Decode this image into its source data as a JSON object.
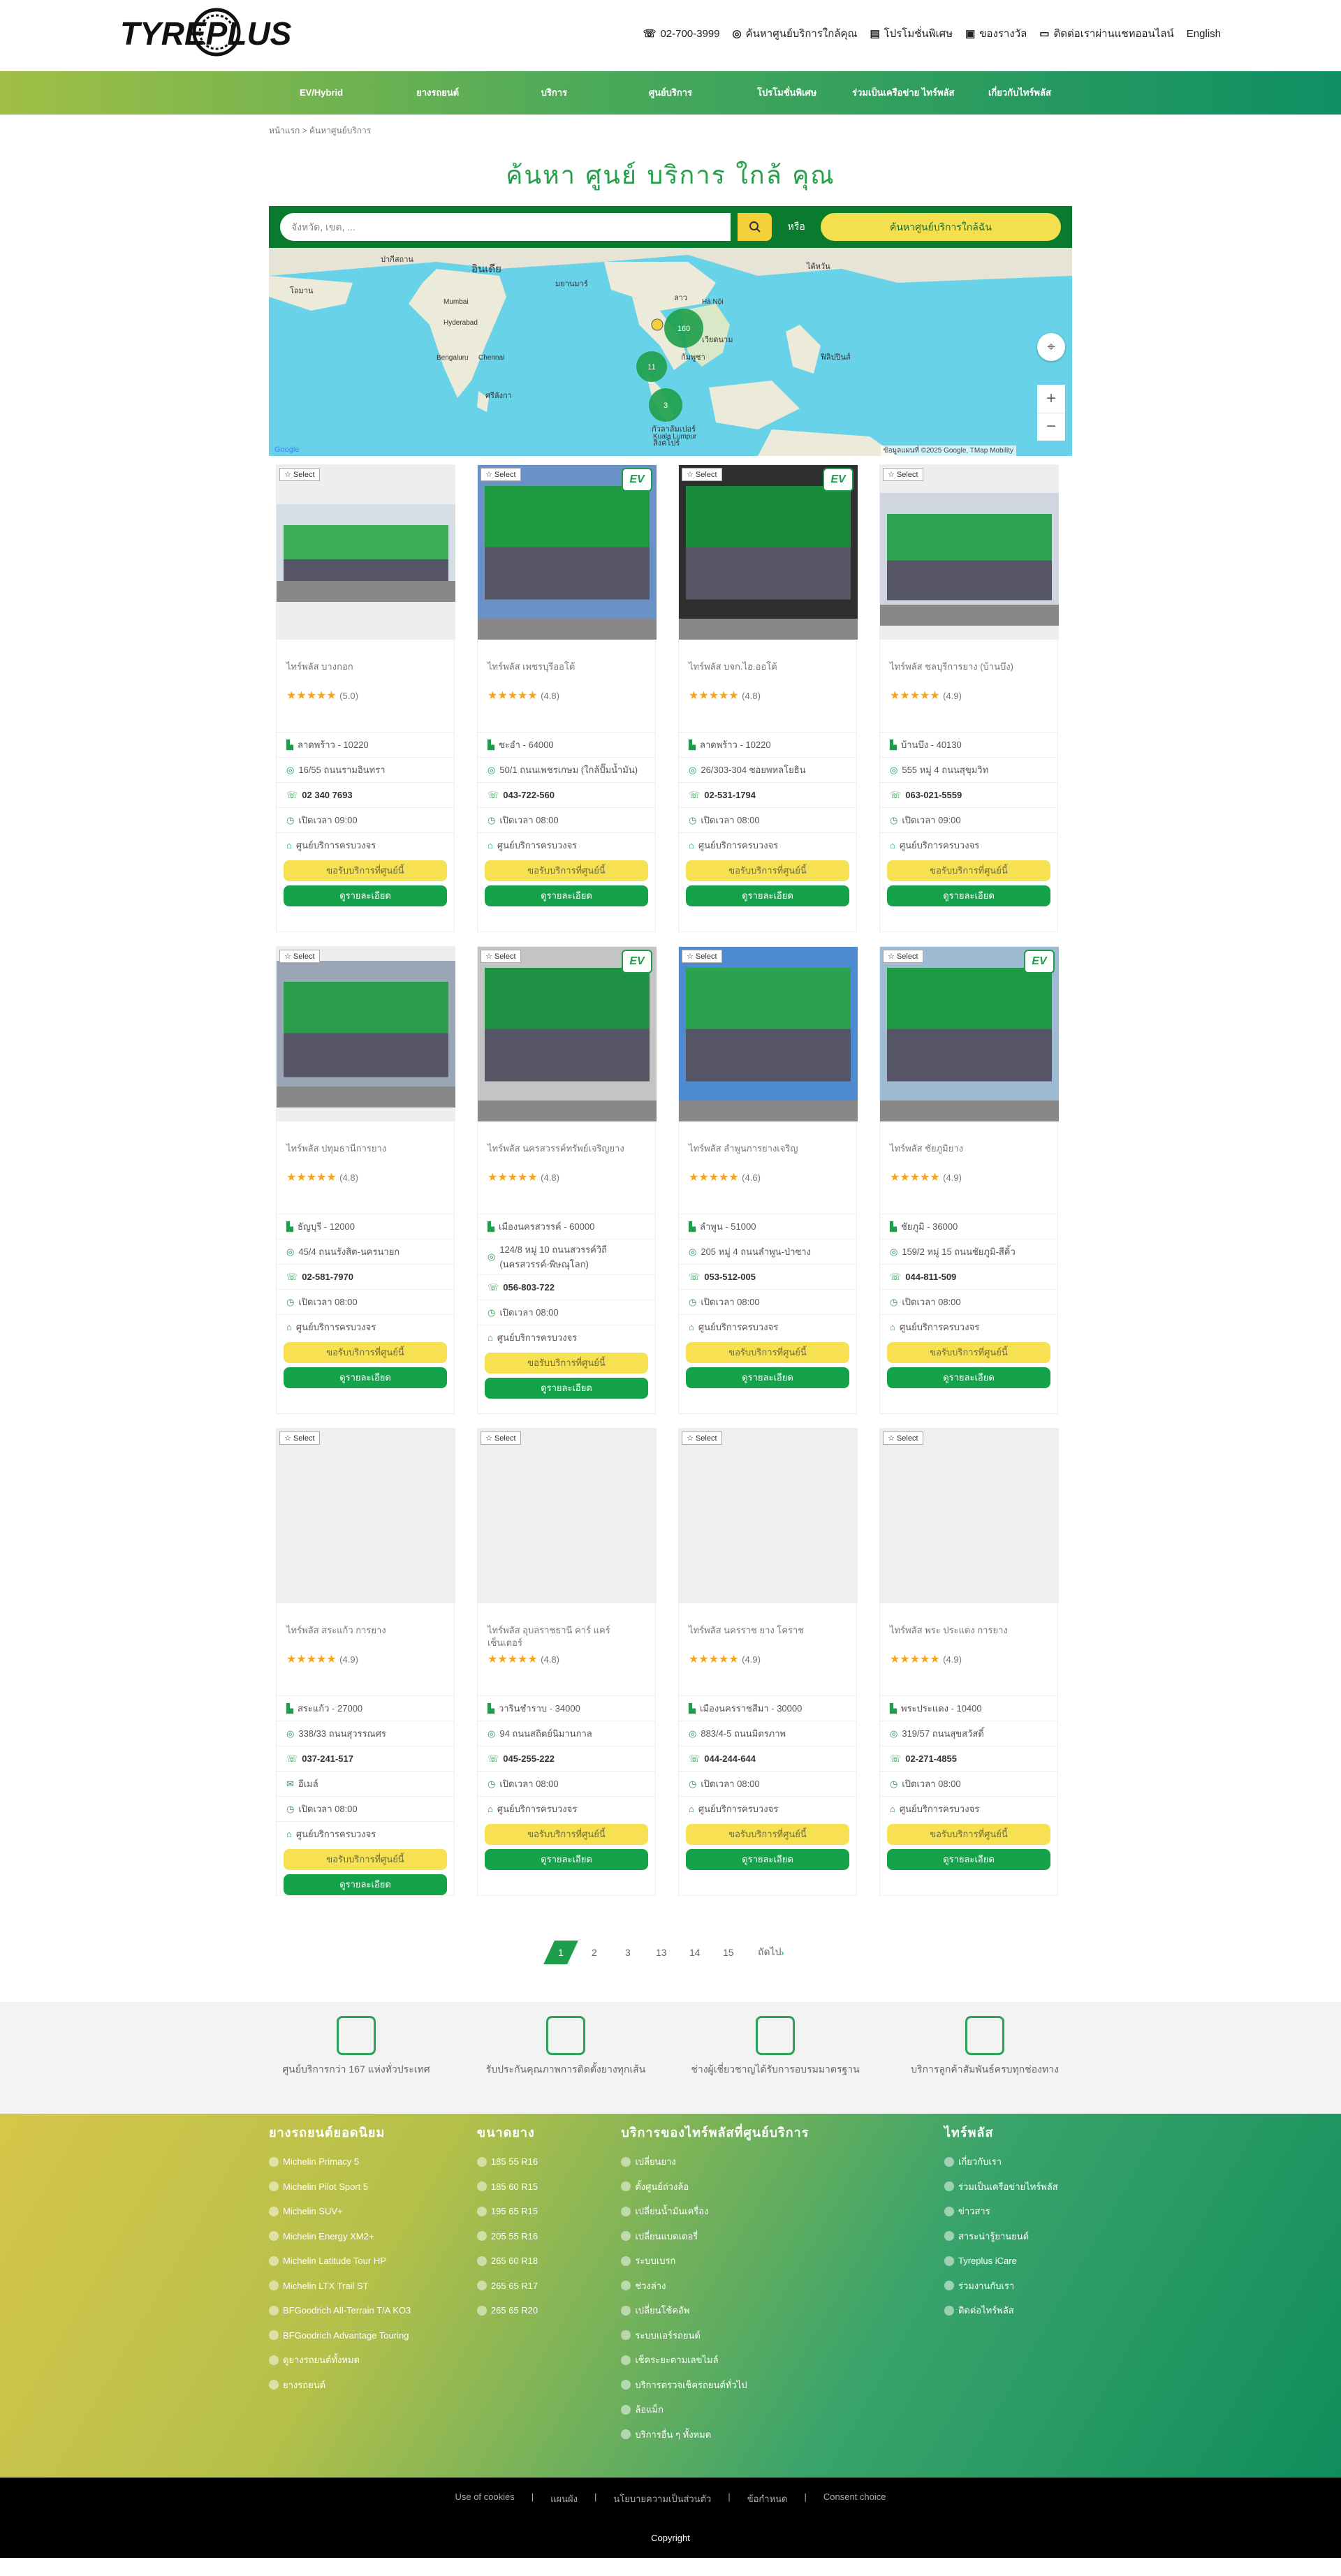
{
  "brand": {
    "logo": "TYREPLUS"
  },
  "util": {
    "phone": "02-700-3999",
    "find_store": "ค้นหาศูนย์บริการใกล้คุณ",
    "promo": "โปรโมชั่นพิเศษ",
    "gift": "ของรางวัล",
    "contact": "ติดต่อเราผ่านแชทออนไลน์",
    "lang": "English"
  },
  "nav": [
    "EV/Hybrid",
    "ยางรถยนต์",
    "บริการ",
    "ศูนย์บริการ",
    "โปรโมชั่นพิเศษ",
    "ร่วมเป็นเครือข่าย ไทร์พลัส",
    "เกี่ยวกับไทร์พลัส"
  ],
  "crumb": "หน้าแรก > ค้นหาศูนย์บริการ",
  "title": "ค้นหา ศูนย์ บริการ ใกล้ คุณ",
  "search": {
    "placeholder": "จังหวัด, เขต, ...",
    "or": "หรือ",
    "near": "ค้นหาศูนย์บริการใกล้ฉัน"
  },
  "map": {
    "labels": [
      "อินเดีย",
      "ปากีสถาน",
      "มยานมาร์",
      "ลาว",
      "ไต้หวัน",
      "โอมาน",
      "กัมพูชา",
      "เวียดนาม",
      "ฟิลิปปินส์",
      "ศรีลังกา",
      "กัวลาลัมเปอร์",
      "สิงคโปร์",
      "Mumbai",
      "Hyderabad",
      "Bengaluru",
      "Chennai",
      "Hà Nội",
      "Kuala Lumpur"
    ],
    "clusters": [
      "160",
      "11",
      "3"
    ],
    "attribution": "ข้อมูลแผนที่ ©2025 Google, TMap Mobility"
  },
  "select_label": "Select",
  "call_btn": "ขอรับบริการที่ศูนย์นี้",
  "detail_btn": "ดูรายละเอียด",
  "stores": [
    {
      "name": "ไทร์พลัส บางกอก",
      "rating": "(5.0)",
      "district": "ลาดพร้าว - 10220",
      "address": "16/55 ถนนรามอินทรา",
      "phone": "02 340 7693",
      "hours": "เปิดเวลา 09:00",
      "type": "ศูนย์บริการครบวงจร",
      "ev": false
    },
    {
      "name": "ไทร์พลัส เพชรบุรีออโต้",
      "rating": "(4.8)",
      "district": "ชะอำ - 64000",
      "address": "50/1 ถนนเพชรเกษม (ใกล้ปั๊มน้ำมัน)",
      "phone": "043-722-560",
      "hours": "เปิดเวลา 08:00",
      "type": "ศูนย์บริการครบวงจร",
      "ev": true
    },
    {
      "name": "ไทร์พลัส บจก.ไฮ.ออโต้",
      "rating": "(4.8)",
      "district": "ลาดพร้าว - 10220",
      "address": "26/303-304 ซอยพหลโยธิน",
      "phone": "02-531-1794",
      "hours": "เปิดเวลา 08:00",
      "type": "ศูนย์บริการครบวงจร",
      "ev": true
    },
    {
      "name": "ไทร์พลัส ชลบุรีการยาง (บ้านบึง)",
      "rating": "(4.9)",
      "district": "บ้านบึง - 40130",
      "address": "555 หมู่ 4 ถนนสุขุมวิท",
      "phone": "063-021-5559",
      "hours": "เปิดเวลา 09:00",
      "type": "ศูนย์บริการครบวงจร",
      "ev": false
    },
    {
      "name": "ไทร์พลัส ปทุมธานีการยาง",
      "rating": "(4.8)",
      "district": "ธัญบุรี - 12000",
      "address": "45/4 ถนนรังสิต-นครนายก",
      "phone": "02-581-7970",
      "hours": "เปิดเวลา 08:00",
      "type": "ศูนย์บริการครบวงจร",
      "ev": false
    },
    {
      "name": "ไทร์พลัส นครสวรรค์ทรัพย์เจริญยาง",
      "rating": "(4.8)",
      "district": "เมืองนครสวรรค์ - 60000",
      "address": "124/8 หมู่ 10 ถนนสวรรค์วิถี (นครสวรรค์-พิษณุโลก)",
      "phone": "056-803-722",
      "hours": "เปิดเวลา 08:00",
      "type": "ศูนย์บริการครบวงจร",
      "ev": true
    },
    {
      "name": "ไทร์พลัส ลำพูนการยางเจริญ",
      "rating": "(4.6)",
      "district": "ลำพูน - 51000",
      "address": "205 หมู่ 4 ถนนลำพูน-ป่าซาง",
      "phone": "053-512-005",
      "hours": "เปิดเวลา 08:00",
      "type": "ศูนย์บริการครบวงจร",
      "ev": false
    },
    {
      "name": "ไทร์พลัส ชัยภูมิยาง",
      "rating": "(4.9)",
      "district": "ชัยภูมิ - 36000",
      "address": "159/2 หมู่ 15 ถนนชัยภูมิ-สีคิ้ว",
      "phone": "044-811-509",
      "hours": "เปิดเวลา 08:00",
      "type": "ศูนย์บริการครบวงจร",
      "ev": true
    },
    {
      "name": "ไทร์พลัส สระแก้ว การยาง",
      "rating": "(4.9)",
      "district": "สระแก้ว - 27000",
      "address": "338/33 ถนนสุวรรณศร",
      "phone": "037-241-517",
      "email": "อีเมล์",
      "hours": "เปิดเวลา 08:00",
      "type": "ศูนย์บริการครบวงจร",
      "ev": false
    },
    {
      "name": "ไทร์พลัส อุบลราชธานี คาร์ แคร์ เซ็นเตอร์",
      "rating": "(4.8)",
      "district": "วารินชำราบ - 34000",
      "address": "94 ถนนสถิตย์นิมานกาล",
      "phone": "045-255-222",
      "hours": "เปิดเวลา 08:00",
      "type": "ศูนย์บริการครบวงจร",
      "ev": false
    },
    {
      "name": "ไทร์พลัส นครราช ยาง โคราช",
      "rating": "(4.9)",
      "district": "เมืองนครราชสีมา - 30000",
      "address": "883/4-5 ถนนมิตรภาพ",
      "phone": "044-244-644",
      "hours": "เปิดเวลา 08:00",
      "type": "ศูนย์บริการครบวงจร",
      "ev": false
    },
    {
      "name": "ไทร์พลัส พระ ประแดง การยาง",
      "rating": "(4.9)",
      "district": "พระประแดง - 10400",
      "address": "319/57 ถนนสุขสวัสดิ์",
      "phone": "02-271-4855",
      "hours": "เปิดเวลา 08:00",
      "type": "ศูนย์บริการครบวงจร",
      "ev": false
    }
  ],
  "pager": [
    "1",
    "2",
    "3",
    "13",
    "14",
    "15",
    "ถัดไป"
  ],
  "services": [
    {
      "text": "ศูนย์บริการกว่า 167 แห่งทั่วประเทศ"
    },
    {
      "text": "รับประกันคุณภาพการติดตั้งยางทุกเส้น"
    },
    {
      "text": "ช่างผู้เชี่ยวชาญได้รับการอบรมมาตรฐาน"
    },
    {
      "text": "บริการลูกค้าสัมพันธ์ครบทุกช่องทาง"
    }
  ],
  "footer": {
    "col1": {
      "title": "ยางรถยนต์ยอดนิยม",
      "items": [
        "Michelin Primacy 5",
        "Michelin Pilot Sport 5",
        "Michelin SUV+",
        "Michelin Energy XM2+",
        "Michelin Latitude Tour HP",
        "Michelin LTX Trail ST",
        "BFGoodrich All-Terrain T/A KO3",
        "BFGoodrich Advantage Touring",
        "ดูยางรถยนต์ทั้งหมด",
        "ยางรถยนต์"
      ]
    },
    "col2": {
      "title": "ขนาดยาง",
      "items": [
        "185 55 R16",
        "185 60 R15",
        "195 65 R15",
        "205 55 R16",
        "265 60 R18",
        "265 65 R17",
        "265 65 R20"
      ]
    },
    "col3": {
      "title": "บริการของไทร์พลัสที่ศูนย์บริการ",
      "items": [
        "เปลี่ยนยาง",
        "ตั้งศูนย์ถ่วงล้อ",
        "เปลี่ยนน้ำมันเครื่อง",
        "เปลี่ยนแบตเตอรี่",
        "ระบบเบรก",
        "ช่วงล่าง",
        "เปลี่ยนโช้คอัพ",
        "ระบบแอร์รถยนต์",
        "เช็คระยะตามเลขไมล์",
        "บริการตรวจเช็ครถยนต์ทั่วไป",
        "ล้อแม็ก",
        "บริการอื่น ๆ ทั้งหมด"
      ]
    },
    "col4": {
      "title": "ไทร์พลัส",
      "items": [
        "เกี่ยวกับเรา",
        "ร่วมเป็นเครือข่ายไทร์พลัส",
        "ข่าวสาร",
        "สาระน่ารู้ยานยนต์",
        "Tyreplus iCare",
        "ร่วมงานกับเรา",
        "ติดต่อไทร์พลัส"
      ]
    }
  },
  "bottom": {
    "links": [
      "Use of cookies",
      "แผนผัง",
      "นโยบายความเป็นส่วนตัว",
      "ข้อกำหนด",
      "Consent choice"
    ],
    "copyright": "Copyright"
  },
  "colors": {
    "green": "#1e9e4a",
    "yellow": "#f7e152",
    "dark_green": "#0a7b2e"
  }
}
